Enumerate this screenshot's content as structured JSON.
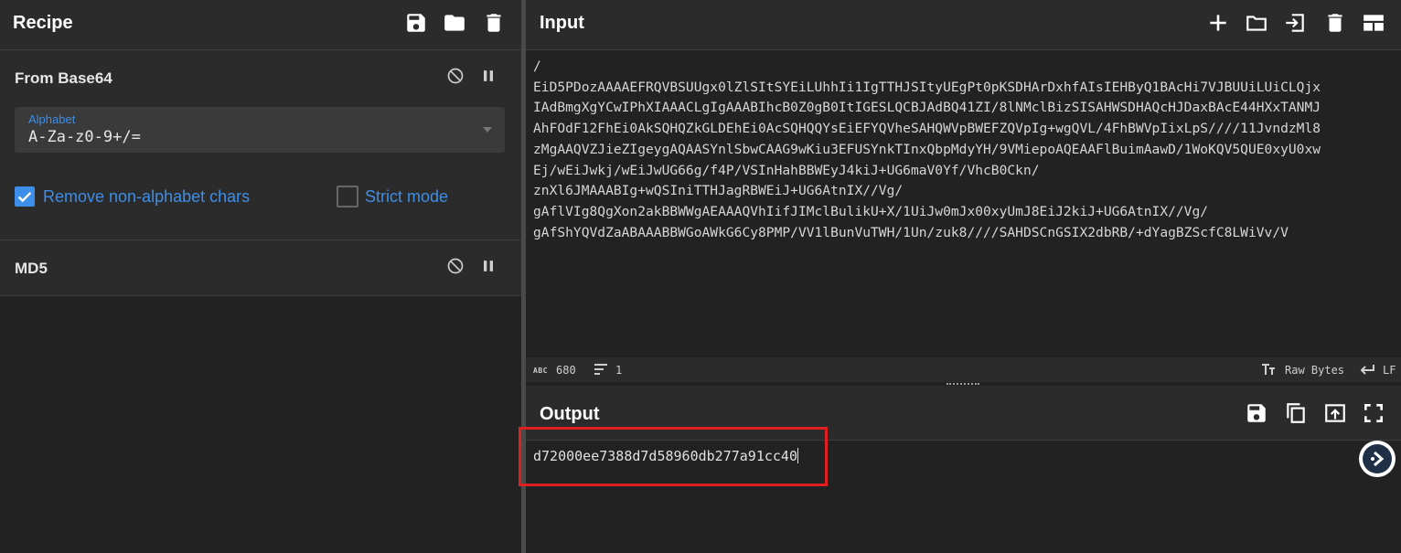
{
  "recipe": {
    "title": "Recipe",
    "header_icons": [
      "save-icon",
      "folder-open-icon",
      "trash-icon"
    ],
    "operations": [
      {
        "name": "From Base64",
        "alphabet_label": "Alphabet",
        "alphabet_value": "A-Za-z0-9+/=",
        "remove_non_alphabet_label": "Remove non-alphabet chars",
        "remove_non_alphabet_checked": true,
        "strict_mode_label": "Strict mode",
        "strict_mode_checked": false
      },
      {
        "name": "MD5"
      }
    ]
  },
  "input": {
    "title": "Input",
    "header_icons": [
      "plus-icon",
      "folder-icon",
      "import-icon",
      "trash-icon",
      "layout-icon"
    ],
    "lines": [
      "/",
      "EiD5PDozAAAAEFRQVBSUUgx0lZlSItSYEiLUhhIi1IgTTHJSItyUEgPt0pKSDHArDxhfAIsIEHByQ1BAcHi7VJBUUiLUiCLQjx",
      "IAdBmgXgYCwIPhXIAAACLgIgAAABIhcB0Z0gB0ItIGESLQCBJAdBQ41ZI/8lNMclBizSISAHWSDHAQcHJDaxBAcE44HXxTANMJ",
      "AhFOdF12FhEi0AkSQHQZkGLDEhEi0AcSQHQQYsEiEFYQVheSAHQWVpBWEFZQVpIg+wgQVL/4FhBWVpIixLpS////11JvndzMl8",
      "zMgAAQVZJieZIgeygAQAASYnlSbwCAAG9wKiu3EFUSYnkTInxQbpMdyYH/9VMiepoAQEAAFlBuimAawD/1WoKQV5QUE0xyU0xw",
      "Ej/wEiJwkj/wEiJwUG66g/f4P/VSInHahBBWEyJ4kiJ+UG6maV0Yf/VhcB0Ckn/",
      "znXl6JMAAABIg+wQSIniTTHJagRBWEiJ+UG6AtnIX//Vg/",
      "gAflVIg8QgXon2akBBWWgAEAAAQVhIifJIMclBulikU+X/1UiJw0mJx00xyUmJ8EiJ2kiJ+UG6AtnIX//Vg/",
      "gAfShYQVdZaABAAABBWGoAWkG6Cy8PMP/VV1lBunVuTWH/1Un/zuk8////SAHDSCnGSIX2dbRB/+dYagBZScfC8LWiVv/V"
    ],
    "char_count": "680",
    "line_count": "1",
    "raw_bytes_label": "Raw Bytes",
    "eol_label": "LF"
  },
  "output": {
    "title": "Output",
    "header_icons": [
      "save-icon",
      "copy-icon",
      "replace-input-icon",
      "fullscreen-icon"
    ],
    "value": "d72000ee7388d7d58960db277a91cc40"
  },
  "colors": {
    "accent": "#3d8ee8",
    "highlight": "#e02020",
    "panel_header": "#2b2b2b",
    "background": "#222222"
  }
}
